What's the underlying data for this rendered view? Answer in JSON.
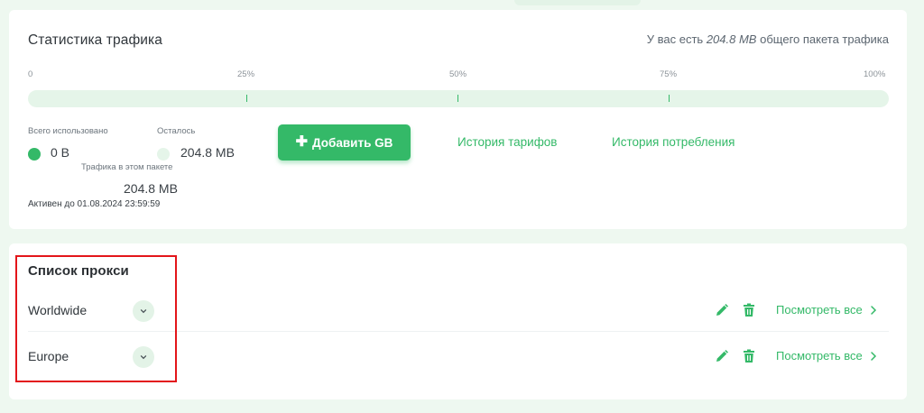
{
  "traffic": {
    "title": "Статистика трафика",
    "package_info": {
      "prefix": "У вас есть",
      "amount": "204.8 MB",
      "suffix": "общего пакета трафика"
    },
    "ticks": [
      "0",
      "25%",
      "50%",
      "75%",
      "100%"
    ],
    "usage_fraction": 0,
    "used_label": "Всего использовано",
    "used_value": "0 B",
    "remaining_label": "Осталось",
    "remaining_value": "204.8 MB",
    "package_label": "Трафика в этом пакете",
    "package_value": "204.8 MB",
    "active_until": "Активен до 01.08.2024 23:59:59",
    "add_button": "Добавить GB",
    "tariff_history": "История тарифов",
    "consumption_history": "История потребления"
  },
  "proxy": {
    "title": "Список прокси",
    "rows": [
      {
        "name": "Worldwide",
        "view_all": "Посмотреть все"
      },
      {
        "name": "Europe",
        "view_all": "Посмотреть все"
      }
    ]
  },
  "colors": {
    "accent": "#34b968",
    "accent_light": "#e3f3e7",
    "background": "#eef8f0",
    "highlight": "#e3151a"
  },
  "icons": [
    "plus-icon",
    "chevron-down-icon",
    "pencil-icon",
    "trash-icon",
    "chevron-right-icon"
  ]
}
